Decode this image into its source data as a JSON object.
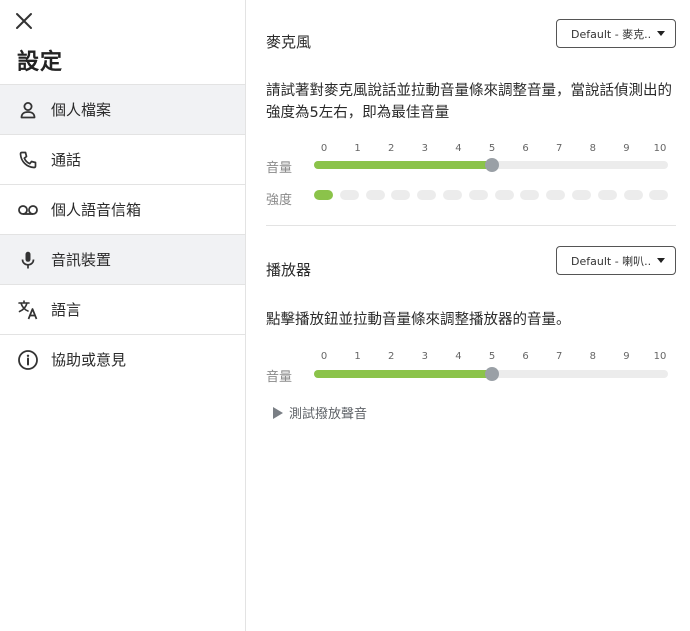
{
  "sidebar": {
    "title": "設定",
    "items": [
      {
        "label": "個人檔案",
        "icon": "person-icon",
        "highlighted": true
      },
      {
        "label": "通話",
        "icon": "phone-icon",
        "highlighted": false
      },
      {
        "label": "個人語音信箱",
        "icon": "voicemail-icon",
        "highlighted": false
      },
      {
        "label": "音訊裝置",
        "icon": "microphone-icon",
        "highlighted": true
      },
      {
        "label": "語言",
        "icon": "translate-icon",
        "highlighted": false
      },
      {
        "label": "協助或意見",
        "icon": "info-icon",
        "highlighted": false
      }
    ]
  },
  "microphone": {
    "title": "麥克風",
    "device": "Default - 麥克...",
    "description": "請試著對麥克風說話並拉動音量條來調整音量，當說話偵測出的強度為5左右，即為最佳音量",
    "ticks": [
      "0",
      "1",
      "2",
      "3",
      "4",
      "5",
      "6",
      "7",
      "8",
      "9",
      "10"
    ],
    "volume_label": "音量",
    "volume_value": 5,
    "level_label": "強度",
    "level_value": 1,
    "level_segments": 14
  },
  "speaker": {
    "title": "播放器",
    "device": "Default - 喇叭...",
    "description": "點擊播放鈕並拉動音量條來調整播放器的音量。",
    "ticks": [
      "0",
      "1",
      "2",
      "3",
      "4",
      "5",
      "6",
      "7",
      "8",
      "9",
      "10"
    ],
    "volume_label": "音量",
    "volume_value": 5,
    "test_button_label": "測試撥放聲音"
  },
  "colors": {
    "accent_green": "#8bc34a",
    "track_gray": "#ececec",
    "thumb_gray": "#9aa0a6",
    "highlight_bg": "#f1f2f4"
  }
}
